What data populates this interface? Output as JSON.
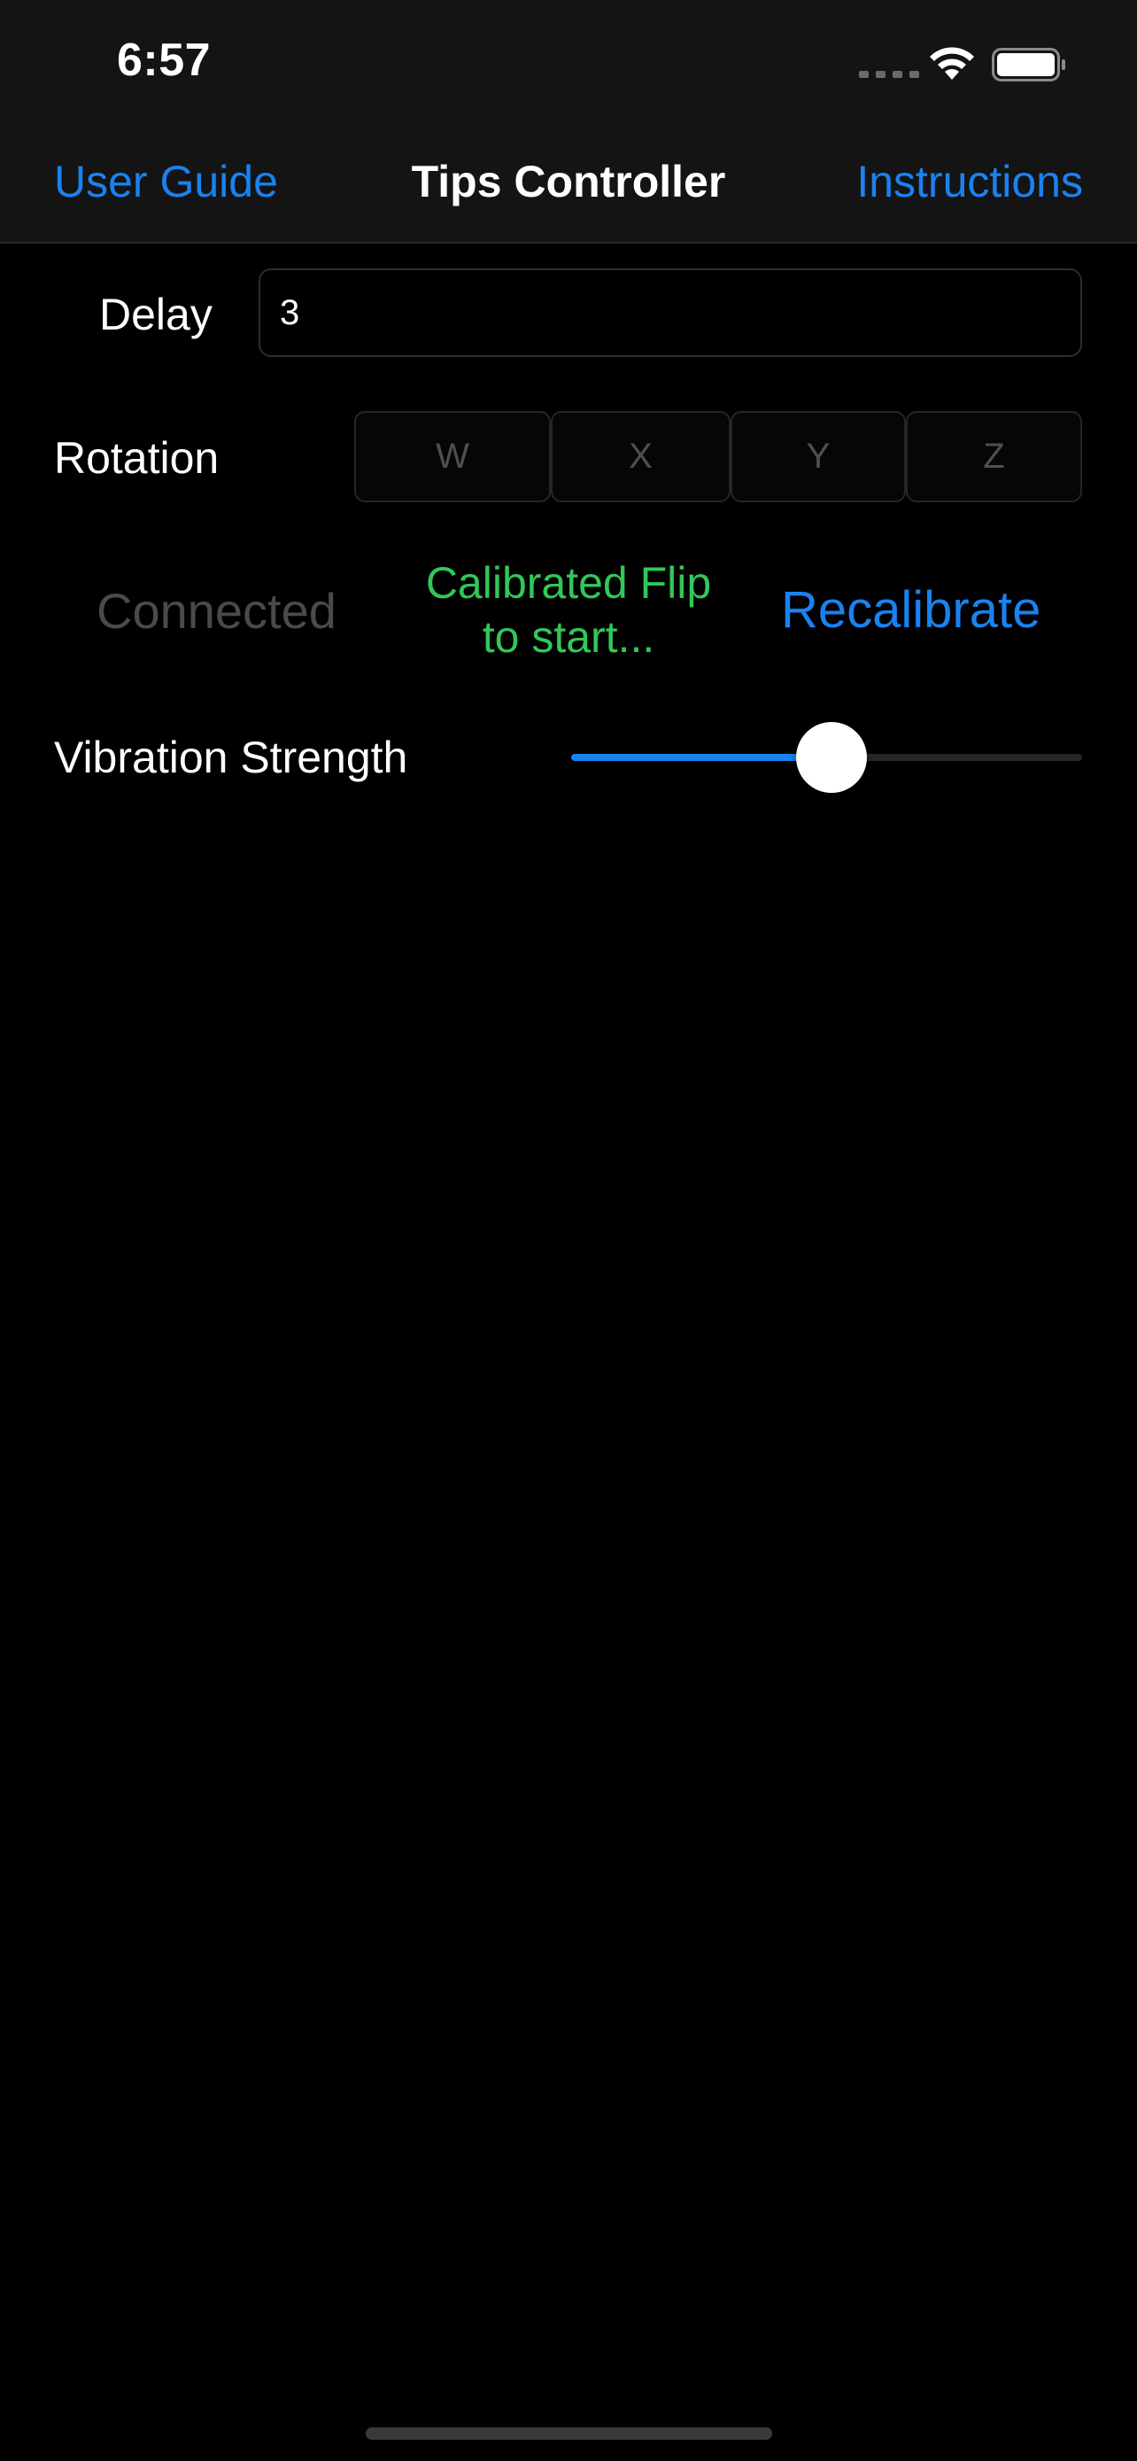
{
  "status_bar": {
    "time": "6:57"
  },
  "nav": {
    "left_label": "User Guide",
    "title": "Tips Controller",
    "right_label": "Instructions"
  },
  "delay": {
    "label": "Delay",
    "value": "3"
  },
  "rotation": {
    "label": "Rotation",
    "options": [
      "W",
      "X",
      "Y",
      "Z"
    ]
  },
  "connection": {
    "status": "Connected",
    "calibration_line1": "Calibrated Flip",
    "calibration_line2": "to start...",
    "recalibrate_label": "Recalibrate"
  },
  "vibration": {
    "label": "Vibration Strength",
    "value": 0.51
  },
  "colors": {
    "accent": "#1a82f0",
    "success": "#32c759",
    "disabled_text": "#4a4a4a"
  },
  "icons": {
    "signal": "cellular-signal-icon",
    "wifi": "wifi-icon",
    "battery": "battery-icon"
  }
}
